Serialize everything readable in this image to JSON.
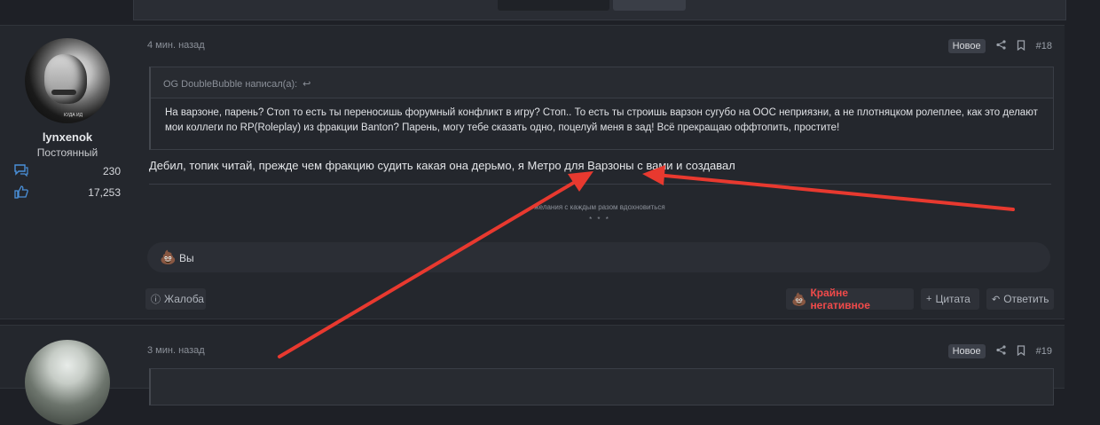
{
  "posts": [
    {
      "number": "#18",
      "date": "4 мин. назад",
      "badge": "Новое",
      "user": {
        "name": "lynxenok",
        "title": "Постоянный",
        "avatar_caption": "КУДА ИД",
        "messages": "230",
        "reactions": "17,253"
      },
      "quote": {
        "author": "OG DoubleBubble написал(а):",
        "text": "На варзоне, парень? Стоп то есть ты переносишь форумный конфликт в игру? Стоп.. То есть ты строишь варзон сугубо на ООС неприязни, а не плотняцком ролеплее, как это делают мои коллеги по RP(Roleplay) из фракции Banton? Парень, могу тебе сказать одно, поцелуй меня в зад! Всё прекращаю оффтопить, простите!"
      },
      "message": "Дебил, топик читай, прежде чем фракцию судить какая она дерьмо, я Метро для Варзоны с вами и создавал",
      "signature": {
        "line1": "желания с каждым разом вдохновиться",
        "line2": "* * *"
      },
      "reactions_bar": {
        "emoji": "💩",
        "who": "Вы"
      },
      "actions": {
        "report": "Жалоба",
        "negative": "Крайне негативное",
        "quote": "Цитата",
        "reply": "Ответить"
      }
    },
    {
      "number": "#19",
      "date": "3 мин. назад",
      "badge": "Новое"
    }
  ],
  "colors": {
    "background": "#1e2026",
    "post_bg": "#24272d",
    "accent_icon": "#4a90d9",
    "negative": "#f04a4a",
    "annotation_arrow": "#e8392f"
  },
  "icons": {
    "messages": "speech-bubble-icon",
    "reactions": "thumbs-up-icon",
    "share": "share-icon",
    "bookmark": "bookmark-icon",
    "return": "return-arrow-icon",
    "report": "alert-circle-icon",
    "poop": "poop-emoji-icon",
    "plus": "plus-icon",
    "reply": "reply-arrow-icon"
  }
}
